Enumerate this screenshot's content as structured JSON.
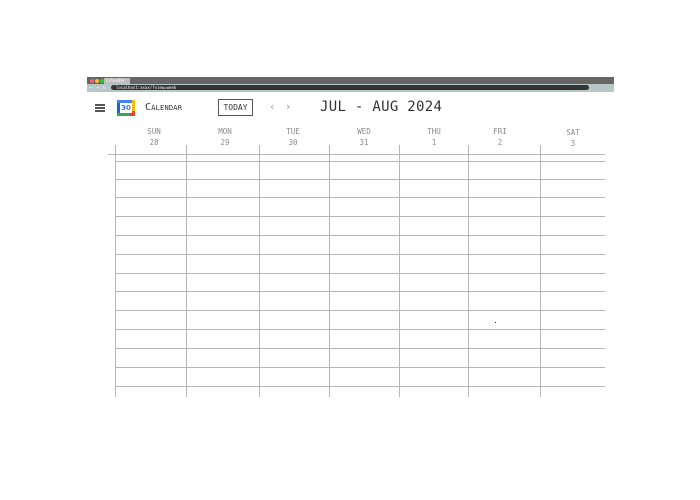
{
  "browser": {
    "tab_title": "Calendar",
    "url": "localhost:xxxx/?view=week"
  },
  "header": {
    "app_name": "Calendar",
    "logo_number": "30",
    "today_label": "TODAY",
    "prev_glyph": "‹",
    "next_glyph": "›",
    "date_range": "JUL - AUG 2024"
  },
  "days": [
    {
      "name": "SUN",
      "date": "28"
    },
    {
      "name": "MON",
      "date": "29"
    },
    {
      "name": "TUE",
      "date": "30"
    },
    {
      "name": "WED",
      "date": "31"
    },
    {
      "name": "THU",
      "date": "1"
    },
    {
      "name": "FRI",
      "date": "2"
    },
    {
      "name": "SAT",
      "date": "3"
    }
  ],
  "colors": {
    "chrome_titlebar": "#666666",
    "address_bar": "#b7c7c7",
    "gridline": "#b5b5b5",
    "logo_blue": "#4285f4",
    "logo_red": "#ea4335",
    "logo_yellow": "#fbbc04",
    "logo_green": "#34a853"
  }
}
